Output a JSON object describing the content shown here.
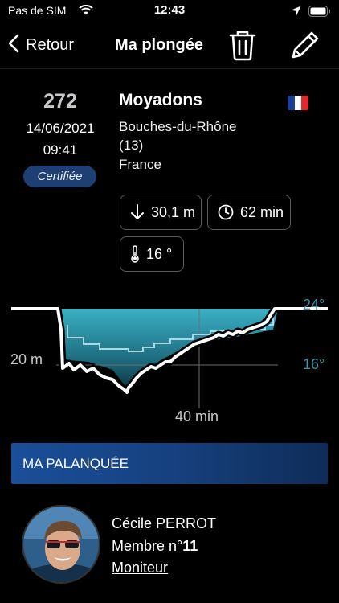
{
  "status_bar": {
    "carrier": "Pas de SIM",
    "time": "12:43",
    "icons": [
      "wifi-icon",
      "location-arrow-icon",
      "battery-icon"
    ]
  },
  "nav": {
    "back_label": "Retour",
    "title": "Ma plongée",
    "actions": [
      "trash-icon",
      "pencil-icon"
    ]
  },
  "dive": {
    "number": "272",
    "date": "14/06/2021",
    "time": "09:41",
    "badge": "Certifiée"
  },
  "site": {
    "name": "Moyadons",
    "region_line1": "Bouches-du-Rhône",
    "region_line2": "(13)",
    "country": "France",
    "flag": "france-flag"
  },
  "stats": {
    "depth": "30,1 m",
    "duration": "62 min",
    "temperature": "16 °"
  },
  "profile": {
    "depth_label": "20 m",
    "time_label": "40 min",
    "temp_max_label": "24°",
    "temp_min_label": "16°"
  },
  "section": {
    "title": "MA PALANQUÉE"
  },
  "member": {
    "name": "Cécile PERROT",
    "number_prefix": "Membre n°",
    "number": "11",
    "role": "Moniteur"
  },
  "colors": {
    "accent_blue": "#1e3f73",
    "water": "#3ba8bd",
    "temp_label": "#3a8fa3"
  }
}
